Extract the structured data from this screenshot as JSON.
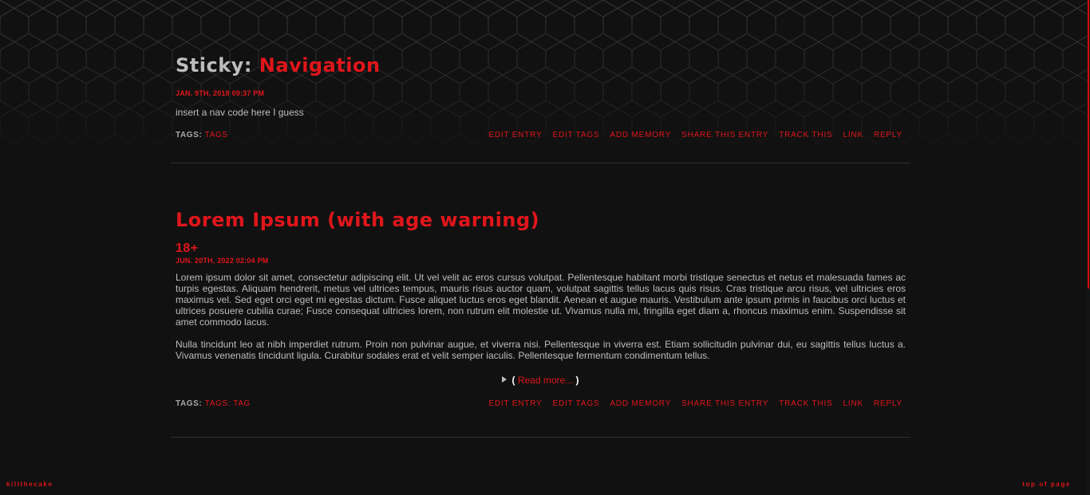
{
  "entries": [
    {
      "prefix": "Sticky:",
      "title": "Navigation",
      "date": "JAN. 9TH, 2018 09:37 PM",
      "body": [
        "insert a nav code here I guess"
      ],
      "tags_label": "TAGS:",
      "tags": "TAGS"
    },
    {
      "title": "Lorem Ipsum (with age warning)",
      "subject_tag": "18+",
      "date": "JUN. 20TH, 2022 02:04 PM",
      "body": [
        "Lorem ipsum dolor sit amet, consectetur adipiscing elit. Ut vel velit ac eros cursus volutpat. Pellentesque habitant morbi tristique senectus et netus et malesuada fames ac turpis egestas. Aliquam hendrerit, metus vel ultrices tempus, mauris risus auctor quam, volutpat sagittis tellus lacus quis risus. Cras tristique arcu risus, vel ultricies eros maximus vel. Sed eget orci eget mi egestas dictum. Fusce aliquet luctus eros eget blandit. Aenean et augue mauris. Vestibulum ante ipsum primis in faucibus orci luctus et ultrices posuere cubilia curae; Fusce consequat ultricies lorem, non rutrum elit molestie ut. Vivamus nulla mi, fringilla eget diam a, rhoncus maximus enim. Suspendisse sit amet commodo lacus.",
        "Nulla tincidunt leo at nibh imperdiet rutrum. Proin non pulvinar augue, et viverra nisi. Pellentesque in viverra est. Etiam sollicitudin pulvinar dui, eu sagittis tellus luctus a. Vivamus venenatis tincidunt ligula. Curabitur sodales erat et velit semper iaculis. Pellentesque fermentum condimentum tellus."
      ],
      "read_more": {
        "open": "(",
        "label": "Read more...",
        "close": ")"
      },
      "tags_label": "TAGS:",
      "tags": "TAGS: TAG"
    }
  ],
  "actions": [
    "EDIT ENTRY",
    "EDIT TAGS",
    "ADD MEMORY",
    "SHARE THIS ENTRY",
    "TRACK THIS",
    "LINK",
    "REPLY"
  ],
  "footer": {
    "site_name": "killthecake",
    "top_link": "top of page"
  },
  "icons": {
    "read_more_toggle": "triangle-right-icon"
  },
  "colors": {
    "accent": "#e0161b",
    "background": "#111111",
    "text": "#bdbdbd",
    "divider": "#2e2e2e"
  }
}
